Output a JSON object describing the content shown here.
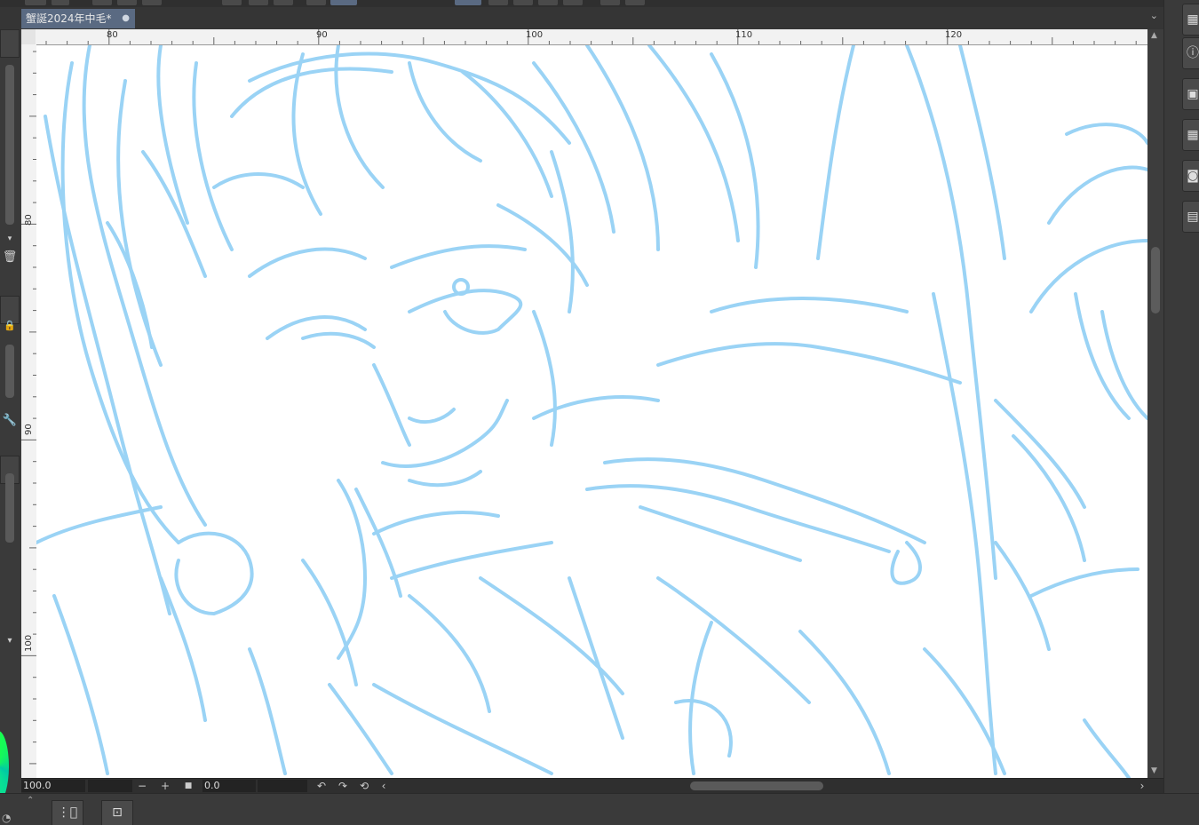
{
  "document_tab": {
    "title": "蟹誕2024年中毛*",
    "modified_dot": "●"
  },
  "tab_bar": {
    "menu_icon": "chevron-down-icon"
  },
  "ruler_top": {
    "labels": [
      "80",
      "90",
      "100",
      "110",
      "120"
    ]
  },
  "ruler_left": {
    "labels": [
      "80",
      "90",
      "100"
    ]
  },
  "status_bar": {
    "zoom_value": "100.0",
    "zoom_out_label": "−",
    "zoom_in_label": "+",
    "fit_label": "■",
    "rotation_value": "0.0",
    "rotate_left_label": "↶",
    "rotate_right_label": "↷",
    "reset_rotation_label": "⟲",
    "scroll_left_label": "‹",
    "scroll_right_label": "›"
  },
  "right_dock": {
    "icons": [
      "navigator-icon",
      "info-icon",
      "layer-property-icon",
      "layer-icon",
      "search-layer-icon",
      "subview-icon"
    ]
  },
  "bottom_dock": {
    "icons": [
      "timeline-icon",
      "camera-icon"
    ]
  },
  "colors": {
    "sketch_line": "#9ad3f5",
    "tab_active": "#5a6a82",
    "ui_dark": "#3a3a3a"
  }
}
